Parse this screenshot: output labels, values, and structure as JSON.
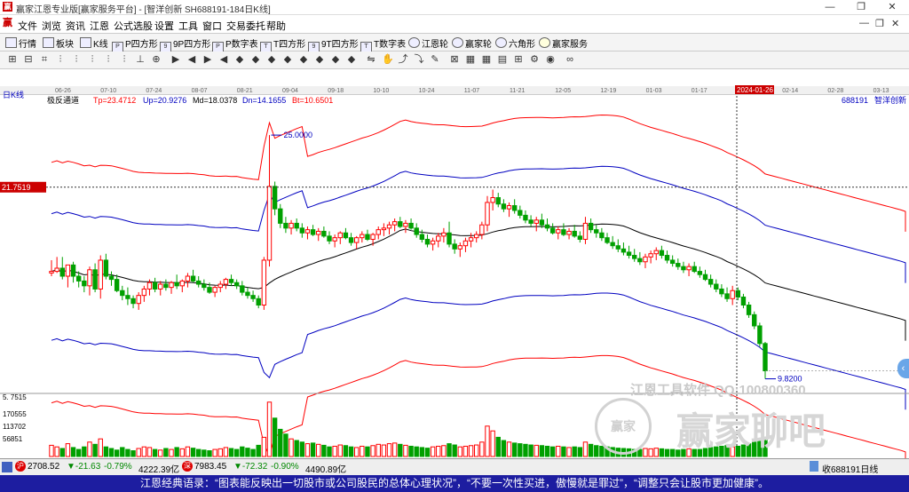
{
  "window": {
    "title": "赢家江恩专业版[赢家服务平台] - [智洋创新  SH688191-184日K线]",
    "min_glyph": "—",
    "restore_glyph": "❐",
    "close_glyph": "✕"
  },
  "menu": {
    "items": [
      "文件",
      "浏览",
      "资讯",
      "江恩",
      "公式选股",
      "设置",
      "工具",
      "窗口",
      "交易委托",
      "帮助"
    ],
    "mdi": [
      "—",
      "❐",
      "✕"
    ]
  },
  "toolbar1": {
    "items": [
      "行情",
      "板块",
      "K线",
      "P四方形",
      "9P四方形",
      "P数字表",
      "T四方形",
      "9T四方形",
      "T数字表",
      "江恩轮",
      "赢家轮",
      "六角形",
      "赢家服务"
    ]
  },
  "chart_data": {
    "type": "candlestick",
    "period_label": "日K线",
    "indicator": {
      "name": "极反通道",
      "values": [
        {
          "label": "Tp",
          "value": "23.4712",
          "color": "#ff0000"
        },
        {
          "label": "Up",
          "value": "20.9276",
          "color": "#0000c0"
        },
        {
          "label": "Md",
          "value": "18.0378",
          "color": "#000000"
        },
        {
          "label": "Dn",
          "value": "14.1655",
          "color": "#0000c0"
        },
        {
          "label": "Bt",
          "value": "10.6501",
          "color": "#ff0000"
        }
      ]
    },
    "stock": {
      "code": "688191",
      "name": "智洋创新"
    },
    "date_axis": [
      "06-26",
      "07-10",
      "07-24",
      "08-07",
      "08-21",
      "09-04",
      "09-18",
      "10-10",
      "10-24",
      "11-07",
      "11-21",
      "12-05",
      "12-19",
      "01-03",
      "01-17",
      "2024-01-26",
      "02-14",
      "02-28",
      "03-13"
    ],
    "cursor_date": "2024-01-26",
    "crosshair_price": "21.7519",
    "annotations": {
      "high": "25.0000",
      "low": "9.8200"
    },
    "volume_axis": [
      "170555",
      "113702",
      "56851"
    ],
    "cursor_volume": "5. 7515",
    "price_min": 9.0,
    "price_max": 27.0,
    "ohlc": [
      [
        16.4,
        16.2,
        17.2,
        16.5
      ],
      [
        16.5,
        16.4,
        17.4,
        16.7
      ],
      [
        16.7,
        16.0,
        17.4,
        16.2
      ],
      [
        16.2,
        15.5,
        16.9,
        16.9
      ],
      [
        16.9,
        15.8,
        17.1,
        16.2
      ],
      [
        16.2,
        15.5,
        16.5,
        15.9
      ],
      [
        15.9,
        15.2,
        16.2,
        15.6
      ],
      [
        15.6,
        15.0,
        16.8,
        16.6
      ],
      [
        16.6,
        15.2,
        17.0,
        15.4
      ],
      [
        15.4,
        14.8,
        17.5,
        17.2
      ],
      [
        17.2,
        16.0,
        17.6,
        16.2
      ],
      [
        16.2,
        15.6,
        16.5,
        16.0
      ],
      [
        16.0,
        15.2,
        16.3,
        15.3
      ],
      [
        15.3,
        14.7,
        15.6,
        15.0
      ],
      [
        15.0,
        14.4,
        15.5,
        14.8
      ],
      [
        14.8,
        14.2,
        15.0,
        14.5
      ],
      [
        14.5,
        14.1,
        15.2,
        15.0
      ],
      [
        15.0,
        14.6,
        15.6,
        15.4
      ],
      [
        15.4,
        15.0,
        16.0,
        15.8
      ],
      [
        15.8,
        15.2,
        16.1,
        15.4
      ],
      [
        15.4,
        15.0,
        15.9,
        15.7
      ],
      [
        15.7,
        15.3,
        16.0,
        15.5
      ],
      [
        15.5,
        15.1,
        15.9,
        15.8
      ],
      [
        15.8,
        15.4,
        16.3,
        15.6
      ],
      [
        15.6,
        15.2,
        16.0,
        15.9
      ],
      [
        15.9,
        15.5,
        16.4,
        16.2
      ],
      [
        16.2,
        15.8,
        16.6,
        15.9
      ],
      [
        15.9,
        15.5,
        16.2,
        15.7
      ],
      [
        15.7,
        15.3,
        16.0,
        15.5
      ],
      [
        15.5,
        15.1,
        15.8,
        15.2
      ],
      [
        15.2,
        14.9,
        15.6,
        15.5
      ],
      [
        15.5,
        15.2,
        15.9,
        15.7
      ],
      [
        15.7,
        15.4,
        16.1,
        16.0
      ],
      [
        16.0,
        15.6,
        16.3,
        15.8
      ],
      [
        15.8,
        15.4,
        16.0,
        15.6
      ],
      [
        15.6,
        15.0,
        15.9,
        15.2
      ],
      [
        15.2,
        14.8,
        15.5,
        15.0
      ],
      [
        15.0,
        14.6,
        15.3,
        14.8
      ],
      [
        14.8,
        14.2,
        15.0,
        14.4
      ],
      [
        14.4,
        14.1,
        17.4,
        17.2
      ],
      [
        17.2,
        16.8,
        25.0,
        21.8
      ],
      [
        21.8,
        20.0,
        22.1,
        20.4
      ],
      [
        20.4,
        19.2,
        20.7,
        19.5
      ],
      [
        19.5,
        18.9,
        19.9,
        19.2
      ],
      [
        19.2,
        18.8,
        19.7,
        19.5
      ],
      [
        19.5,
        19.0,
        19.8,
        19.2
      ],
      [
        19.2,
        18.6,
        19.5,
        18.9
      ],
      [
        18.9,
        18.5,
        19.3,
        19.1
      ],
      [
        19.1,
        18.7,
        19.4,
        18.8
      ],
      [
        18.8,
        18.4,
        19.2,
        19.0
      ],
      [
        19.0,
        18.6,
        19.3,
        18.7
      ],
      [
        18.7,
        18.2,
        19.0,
        18.4
      ],
      [
        18.4,
        18.0,
        18.8,
        18.6
      ],
      [
        18.6,
        18.2,
        19.0,
        18.9
      ],
      [
        18.9,
        18.5,
        19.2,
        18.6
      ],
      [
        18.6,
        18.1,
        18.9,
        18.3
      ],
      [
        18.3,
        17.9,
        18.7,
        18.6
      ],
      [
        18.6,
        18.3,
        19.0,
        18.8
      ],
      [
        18.8,
        18.4,
        19.1,
        18.5
      ],
      [
        18.5,
        18.1,
        18.9,
        18.8
      ],
      [
        18.8,
        18.5,
        19.3,
        19.1
      ],
      [
        19.1,
        18.7,
        19.5,
        19.2
      ],
      [
        19.2,
        18.8,
        19.6,
        19.4
      ],
      [
        19.4,
        19.0,
        19.8,
        19.6
      ],
      [
        19.6,
        19.2,
        19.9,
        19.3
      ],
      [
        19.3,
        18.9,
        19.7,
        19.5
      ],
      [
        19.5,
        19.1,
        19.8,
        19.2
      ],
      [
        19.2,
        18.6,
        19.5,
        18.8
      ],
      [
        18.8,
        18.3,
        19.1,
        18.5
      ],
      [
        18.5,
        18.0,
        18.8,
        18.2
      ],
      [
        18.2,
        17.8,
        18.6,
        18.4
      ],
      [
        18.4,
        18.0,
        18.9,
        18.7
      ],
      [
        18.7,
        18.3,
        19.2,
        18.9
      ],
      [
        18.9,
        18.0,
        19.6,
        18.2
      ],
      [
        18.2,
        17.6,
        18.5,
        17.9
      ],
      [
        17.9,
        17.4,
        18.3,
        18.1
      ],
      [
        18.1,
        17.7,
        18.6,
        18.4
      ],
      [
        18.4,
        18.0,
        18.9,
        18.6
      ],
      [
        18.6,
        18.3,
        19.0,
        18.8
      ],
      [
        18.8,
        18.5,
        19.6,
        19.4
      ],
      [
        19.4,
        19.0,
        21.2,
        20.8
      ],
      [
        20.8,
        20.3,
        21.6,
        21.1
      ],
      [
        21.1,
        20.5,
        21.4,
        20.7
      ],
      [
        20.7,
        20.2,
        21.0,
        20.4
      ],
      [
        20.4,
        19.9,
        20.8,
        20.6
      ],
      [
        20.6,
        20.1,
        21.0,
        20.3
      ],
      [
        20.3,
        19.8,
        20.6,
        20.0
      ],
      [
        20.0,
        19.5,
        20.3,
        19.7
      ],
      [
        19.7,
        19.3,
        20.0,
        19.5
      ],
      [
        19.5,
        19.0,
        19.9,
        19.7
      ],
      [
        19.7,
        19.2,
        20.1,
        19.4
      ],
      [
        19.4,
        19.0,
        19.8,
        19.2
      ],
      [
        19.2,
        18.8,
        19.5,
        18.9
      ],
      [
        18.9,
        18.5,
        19.3,
        19.1
      ],
      [
        19.1,
        18.7,
        19.5,
        18.8
      ],
      [
        18.8,
        18.5,
        19.2,
        19.0
      ],
      [
        19.0,
        18.6,
        19.4,
        18.7
      ],
      [
        18.7,
        18.3,
        19.0,
        18.5
      ],
      [
        18.5,
        18.2,
        19.9,
        19.5
      ],
      [
        19.5,
        18.9,
        19.8,
        19.1
      ],
      [
        19.1,
        18.6,
        19.4,
        18.9
      ],
      [
        18.9,
        18.4,
        19.2,
        18.6
      ],
      [
        18.6,
        18.2,
        18.9,
        18.3
      ],
      [
        18.3,
        17.9,
        18.7,
        18.1
      ],
      [
        18.1,
        17.7,
        18.5,
        17.9
      ],
      [
        17.9,
        17.5,
        18.3,
        17.7
      ],
      [
        17.7,
        17.3,
        18.1,
        17.5
      ],
      [
        17.5,
        17.1,
        17.9,
        17.3
      ],
      [
        17.3,
        16.9,
        17.7,
        17.1
      ],
      [
        17.1,
        16.7,
        17.6,
        17.4
      ],
      [
        17.4,
        17.0,
        17.8,
        17.6
      ],
      [
        17.6,
        17.2,
        18.0,
        17.8
      ],
      [
        17.8,
        17.3,
        18.1,
        17.5
      ],
      [
        17.5,
        17.0,
        17.8,
        17.2
      ],
      [
        17.2,
        16.8,
        17.5,
        17.0
      ],
      [
        17.0,
        16.6,
        17.3,
        16.8
      ],
      [
        16.8,
        16.4,
        17.1,
        16.6
      ],
      [
        16.6,
        16.2,
        17.0,
        16.8
      ],
      [
        16.8,
        16.4,
        17.1,
        16.5
      ],
      [
        16.5,
        16.1,
        16.8,
        16.3
      ],
      [
        16.3,
        15.9,
        16.6,
        16.0
      ],
      [
        16.0,
        15.5,
        16.3,
        15.7
      ],
      [
        15.7,
        15.2,
        16.0,
        15.4
      ],
      [
        15.4,
        14.9,
        15.7,
        15.1
      ],
      [
        15.1,
        14.6,
        15.5,
        14.8
      ],
      [
        14.8,
        14.4,
        15.6,
        15.3
      ],
      [
        15.3,
        14.7,
        15.5,
        14.9
      ],
      [
        14.9,
        14.2,
        15.1,
        14.4
      ],
      [
        14.4,
        13.6,
        14.6,
        13.8
      ],
      [
        13.8,
        12.9,
        14.0,
        13.1
      ],
      [
        13.1,
        11.8,
        13.3,
        12.0
      ],
      [
        12.0,
        9.8,
        12.1,
        10.3
      ]
    ],
    "volumes": [
      35,
      30,
      25,
      40,
      28,
      22,
      30,
      45,
      38,
      55,
      30,
      25,
      20,
      28,
      22,
      18,
      25,
      30,
      28,
      22,
      20,
      25,
      22,
      28,
      24,
      30,
      26,
      22,
      20,
      18,
      22,
      24,
      28,
      25,
      22,
      30,
      26,
      22,
      35,
      60,
      170,
      120,
      85,
      70,
      55,
      50,
      45,
      40,
      42,
      38,
      35,
      30,
      32,
      36,
      34,
      30,
      28,
      32,
      30,
      34,
      38,
      36,
      40,
      42,
      38,
      35,
      32,
      30,
      28,
      26,
      30,
      32,
      34,
      40,
      36,
      30,
      32,
      34,
      36,
      45,
      95,
      80,
      60,
      50,
      45,
      42,
      40,
      38,
      36,
      35,
      34,
      32,
      30,
      32,
      30,
      28,
      30,
      28,
      45,
      38,
      34,
      32,
      30,
      28,
      26,
      25,
      24,
      22,
      22,
      25,
      24,
      26,
      24,
      22,
      22,
      20,
      22,
      24,
      22,
      22,
      25,
      28,
      30,
      32,
      34,
      30,
      32,
      36,
      40,
      45,
      50,
      60
    ]
  },
  "statusbar": {
    "sh_icon": "沪",
    "sh_index": "2708.52",
    "sh_change": "▼-21.63",
    "sh_pct": "-0.79%",
    "sh_amount": "4222.39亿",
    "sz_icon": "深",
    "sz_index": "7983.45",
    "sz_change": "▼-72.32",
    "sz_pct": "-0.90%",
    "sz_amount": "4490.89亿",
    "right_text": "收688191日线"
  },
  "watermark": {
    "line1": "江恩工具软件  QQ:100800360",
    "brand": "赢家聊吧",
    "badge": "赢家"
  },
  "quote": "江恩经典语录：“图表能反映出一切股市或公司股民的总体心理状况”，“不要一次性买进，傲慢就是罪过”，“调整只会让股市更加健康”。",
  "side_arrow": "‹",
  "colors": {
    "up": "#ff0000",
    "down": "#00a000",
    "upper_band": "#ff0000",
    "inner_band": "#0000c0",
    "mid": "#000000"
  }
}
